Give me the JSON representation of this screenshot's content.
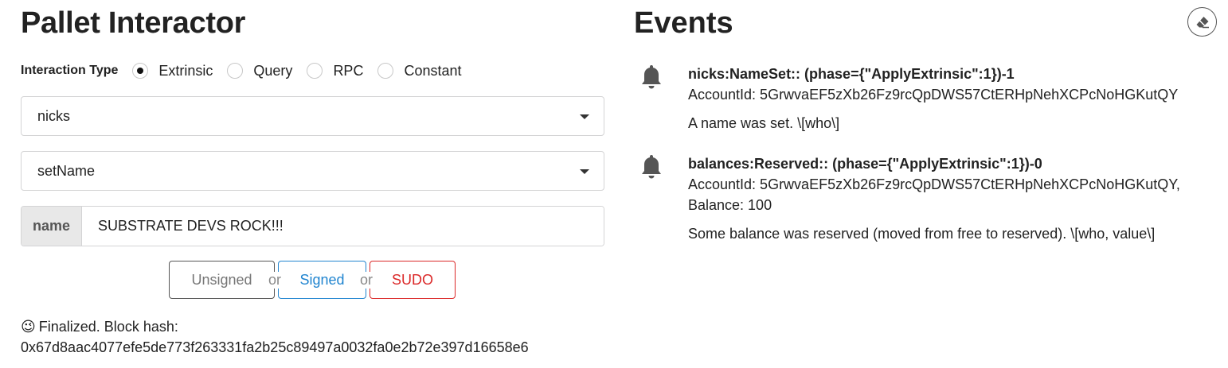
{
  "pallet": {
    "title": "Pallet Interactor",
    "interaction_label": "Interaction Type",
    "interaction_types": [
      "Extrinsic",
      "Query",
      "RPC",
      "Constant"
    ],
    "selected_interaction": "Extrinsic",
    "pallet_select": "nicks",
    "callable_select": "setName",
    "param_label": "name",
    "param_value": "SUBSTRATE DEVS ROCK!!!",
    "buttons": {
      "unsigned": "Unsigned",
      "or": "or",
      "signed": "Signed",
      "sudo": "SUDO"
    },
    "status": {
      "emoji": "😉",
      "line1": "Finalized. Block hash:",
      "hash": "0x67d8aac4077efe5de773f263331fa2b25c89497a0032fa0e2b72e397d16658e6"
    }
  },
  "events": {
    "title": "Events",
    "clear_icon": "eraser-icon",
    "items": [
      {
        "icon": "bell-icon",
        "header": "nicks:NameSet:: (phase={\"ApplyExtrinsic\":1})-1",
        "data_line1": "AccountId: 5GrwvaEF5zXb26Fz9rcQpDWS57CtERHpNehXCPcNoHGKutQY",
        "data_line2": "",
        "description": "A name was set. \\[who\\]"
      },
      {
        "icon": "bell-icon",
        "header": "balances:Reserved:: (phase={\"ApplyExtrinsic\":1})-0",
        "data_line1": "AccountId: 5GrwvaEF5zXb26Fz9rcQpDWS57CtERHpNehXCPcNoHGKutQY,",
        "data_line2": "Balance: 100",
        "description": "Some balance was reserved (moved from free to reserved). \\[who, value\\]"
      }
    ]
  },
  "colors": {
    "signed": "#2185d0",
    "sudo": "#db2828",
    "label_bg": "#e8e8e8"
  }
}
